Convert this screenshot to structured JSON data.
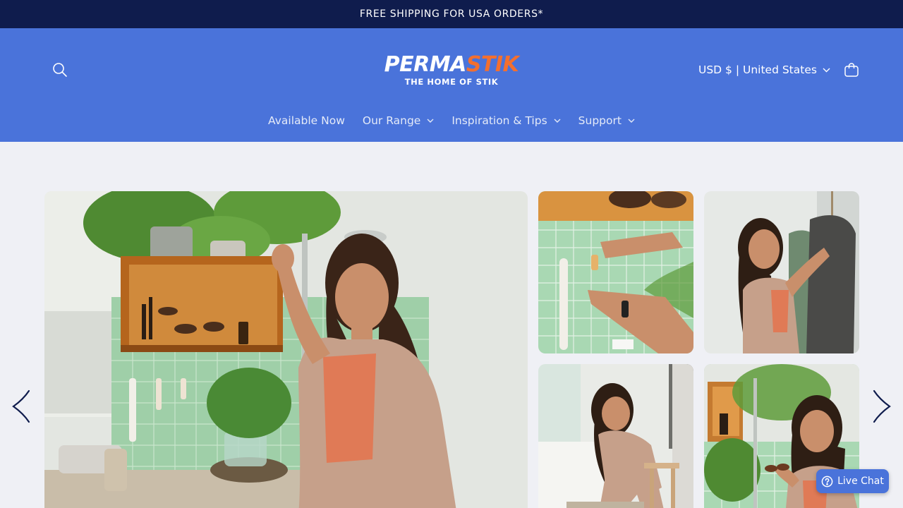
{
  "announcement": "FREE SHIPPING FOR USA ORDERS*",
  "header": {
    "logo": {
      "main_left": "PERMA",
      "main_right": "STIK",
      "tagline": "THE HOME OF STIK"
    },
    "currency_selector": "USD $ | United States",
    "icons": {
      "search": "search-icon",
      "cart": "cart-icon"
    }
  },
  "nav": {
    "items": [
      {
        "label": "Available Now",
        "dropdown": false
      },
      {
        "label": "Our Range",
        "dropdown": true
      },
      {
        "label": "Inspiration & Tips",
        "dropdown": true
      },
      {
        "label": "Support",
        "dropdown": true
      }
    ]
  },
  "gallery": {
    "main_image": "woman-bathroom-shelf-photo",
    "thumbnails": [
      "hands-attaching-hook-photo",
      "woman-hanging-towel-photo",
      "woman-seated-stool-photo",
      "woman-holding-glasses-photo"
    ],
    "prev_icon": "chevron-left-icon",
    "next_icon": "chevron-right-icon"
  },
  "live_chat": {
    "label": "Live Chat",
    "icon": "help-circle-icon"
  },
  "colors": {
    "announcement_bg": "#0f1c4d",
    "header_bg": "#4a73da",
    "brand_orange": "#f36f2f",
    "page_bg": "#eff0f5",
    "arrow": "#0f1c4d"
  }
}
